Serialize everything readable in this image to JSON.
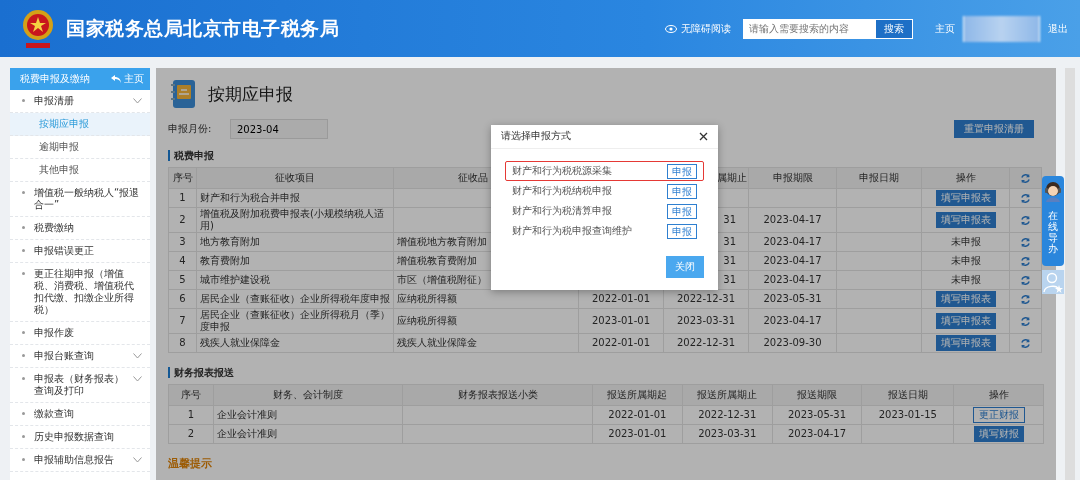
{
  "header": {
    "title": "国家税务总局北京市电子税务局",
    "accessibility": "无障碍阅读",
    "search": {
      "placeholder": "请输入需要搜索的内容",
      "button": "搜索"
    },
    "nav": [
      "主页",
      "退出"
    ]
  },
  "sidebar": {
    "title": "税费申报及缴纳",
    "home": "主页",
    "items": [
      {
        "label": "申报清册",
        "kind": "group",
        "children": [
          {
            "label": "按期应申报",
            "selected": true
          },
          {
            "label": "逾期申报",
            "selected": false
          },
          {
            "label": "其他申报",
            "selected": false
          }
        ]
      },
      {
        "label": "增值税一般纳税人“报退合一”",
        "kind": "link"
      },
      {
        "label": "税费缴纳",
        "kind": "link"
      },
      {
        "label": "申报错误更正",
        "kind": "link"
      },
      {
        "label": "更正往期申报（增值税、消费税、增值税代扣代缴、扣缴企业所得税）",
        "kind": "link"
      },
      {
        "label": "申报作废",
        "kind": "link"
      },
      {
        "label": "申报台账查询",
        "kind": "group"
      },
      {
        "label": "申报表（财务报表）查询及打印",
        "kind": "group"
      },
      {
        "label": "缴款查询",
        "kind": "link"
      },
      {
        "label": "历史申报数据查询",
        "kind": "link"
      },
      {
        "label": "申报辅助信息报告",
        "kind": "group"
      }
    ]
  },
  "page": {
    "title": "按期应申报",
    "month_label": "申报月份:",
    "month_value": "2023-04",
    "reset_button": "重置申报清册"
  },
  "tax_section": {
    "title": "税费申报",
    "columns": [
      "序号",
      "征收项目",
      "征收品",
      "",
      "属期止",
      "申报期限",
      "申报日期",
      "操作"
    ],
    "rows": [
      {
        "no": "1",
        "item": "财产和行为税合并申报",
        "product": "",
        "start": "",
        "end": "",
        "deadline": "",
        "date": "",
        "op": {
          "kind": "button",
          "text": "填写申报表"
        }
      },
      {
        "no": "2",
        "item": "增值税及附加税费申报表(小规模纳税人适用)",
        "product": "",
        "start": "",
        "end": "31",
        "deadline": "2023-04-17",
        "date": "",
        "op": {
          "kind": "button",
          "text": "填写申报表"
        }
      },
      {
        "no": "3",
        "item": "地方教育附加",
        "product": "增值税地方教育附加",
        "start": "",
        "end": "31",
        "deadline": "2023-04-17",
        "date": "",
        "op": {
          "kind": "status",
          "text": "未申报"
        }
      },
      {
        "no": "4",
        "item": "教育费附加",
        "product": "增值税教育费附加",
        "start": "",
        "end": "31",
        "deadline": "2023-04-17",
        "date": "",
        "op": {
          "kind": "status",
          "text": "未申报"
        }
      },
      {
        "no": "5",
        "item": "城市维护建设税",
        "product": "市区（增值税附征）",
        "start": "",
        "end": "31",
        "deadline": "2023-04-17",
        "date": "",
        "op": {
          "kind": "status",
          "text": "未申报"
        }
      },
      {
        "no": "6",
        "item": "居民企业（查账征收）企业所得税年度申报",
        "product": "应纳税所得额",
        "start": "2022-01-01",
        "end": "2022-12-31",
        "deadline": "2023-05-31",
        "date": "",
        "op": {
          "kind": "button",
          "text": "填写申报表"
        }
      },
      {
        "no": "7",
        "item": "居民企业（查账征收）企业所得税月（季）度申报",
        "product": "应纳税所得额",
        "start": "2023-01-01",
        "end": "2023-03-31",
        "deadline": "2023-04-17",
        "date": "",
        "op": {
          "kind": "button",
          "text": "填写申报表"
        }
      },
      {
        "no": "8",
        "item": "残疾人就业保障金",
        "product": "残疾人就业保障金",
        "start": "2022-01-01",
        "end": "2022-12-31",
        "deadline": "2023-09-30",
        "date": "",
        "op": {
          "kind": "button",
          "text": "填写申报表"
        }
      }
    ]
  },
  "finance_section": {
    "title": "财务报表报送",
    "columns": [
      "序号",
      "财务、会计制度",
      "财务报表报送小类",
      "报送所属期起",
      "报送所属期止",
      "报送期限",
      "报送日期",
      "操作"
    ],
    "rows": [
      {
        "no": "1",
        "system": "企业会计准则",
        "sub": "",
        "start": "2022-01-01",
        "end": "2022-12-31",
        "deadline": "2023-05-31",
        "date": "2023-01-15",
        "op": {
          "kind": "outline",
          "text": "更正财报"
        }
      },
      {
        "no": "2",
        "system": "企业会计准则",
        "sub": "",
        "start": "2023-01-01",
        "end": "2023-03-31",
        "deadline": "2023-04-17",
        "date": "",
        "op": {
          "kind": "filled",
          "text": "填写财报"
        }
      }
    ]
  },
  "tips_title": "温馨提示",
  "dialog": {
    "title": "请选择申报方式",
    "options": [
      {
        "label": "财产和行为税税源采集",
        "button": "申报",
        "selected": true
      },
      {
        "label": "财产和行为税纳税申报",
        "button": "申报",
        "selected": false
      },
      {
        "label": "财产和行为税清算申报",
        "button": "申报",
        "selected": false
      },
      {
        "label": "财产和行为税申报查询维护",
        "button": "申报",
        "selected": false
      }
    ],
    "close_button": "关闭"
  },
  "helper": {
    "label": "在线导办"
  }
}
